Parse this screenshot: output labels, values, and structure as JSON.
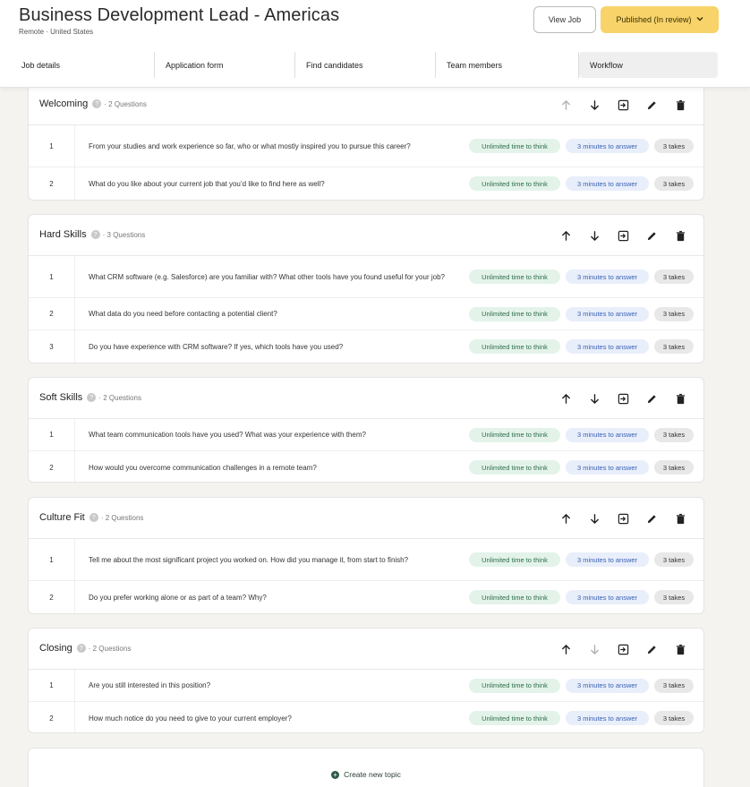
{
  "header": {
    "title": "Business Development Lead - Americas",
    "location": "Remote · United States",
    "view_job_label": "View Job",
    "status_label": "Published (In review)"
  },
  "tabs": [
    {
      "label": "Job details",
      "active": false
    },
    {
      "label": "Application form",
      "active": false
    },
    {
      "label": "Find candidates",
      "active": false
    },
    {
      "label": "Team members",
      "active": false
    },
    {
      "label": "Workflow",
      "active": true
    }
  ],
  "badges": {
    "think": "Unlimited time to think",
    "answer": "3 minutes to answer",
    "takes": "3 takes"
  },
  "sections": [
    {
      "title": "Welcoming",
      "meta": "· 2 Questions",
      "questions": [
        {
          "num": "1",
          "text": "From your studies and work experience so far, who or what mostly inspired you to pursue this career?"
        },
        {
          "num": "2",
          "text": "What do you like about your current job that you’d like to find here as well?"
        }
      ]
    },
    {
      "title": "Hard Skills",
      "meta": "· 3 Questions",
      "questions": [
        {
          "num": "1",
          "text": "What CRM software (e.g. Salesforce) are you familiar with? What other tools have you found useful for your job?"
        },
        {
          "num": "2",
          "text": "What data do you need before contacting a potential client?"
        },
        {
          "num": "3",
          "text": "Do you have experience with CRM software? If yes, which tools have you used?"
        }
      ]
    },
    {
      "title": "Soft Skills",
      "meta": "· 2 Questions",
      "questions": [
        {
          "num": "1",
          "text": "What team communication tools have you used? What was your experience with them?"
        },
        {
          "num": "2",
          "text": "How would you overcome communication challenges in a remote team?"
        }
      ]
    },
    {
      "title": "Culture Fit",
      "meta": "· 2 Questions",
      "questions": [
        {
          "num": "1",
          "text": "Tell me about the most significant project you worked on. How did you manage it, from start to finish?"
        },
        {
          "num": "2",
          "text": "Do you prefer working alone or as part of a team? Why?"
        }
      ]
    },
    {
      "title": "Closing",
      "meta": "· 2 Questions",
      "questions": [
        {
          "num": "1",
          "text": "Are you still interested in this position?"
        },
        {
          "num": "2",
          "text": "How much notice do you need to give to your current employer?"
        }
      ]
    }
  ],
  "create_topic_label": "Create new topic",
  "colors": {
    "accent_yellow": "#f7d36a",
    "think_badge_bg": "#e3f3ea",
    "answer_badge_bg": "#e8eefa",
    "takes_badge_bg": "#e8e8e8"
  }
}
